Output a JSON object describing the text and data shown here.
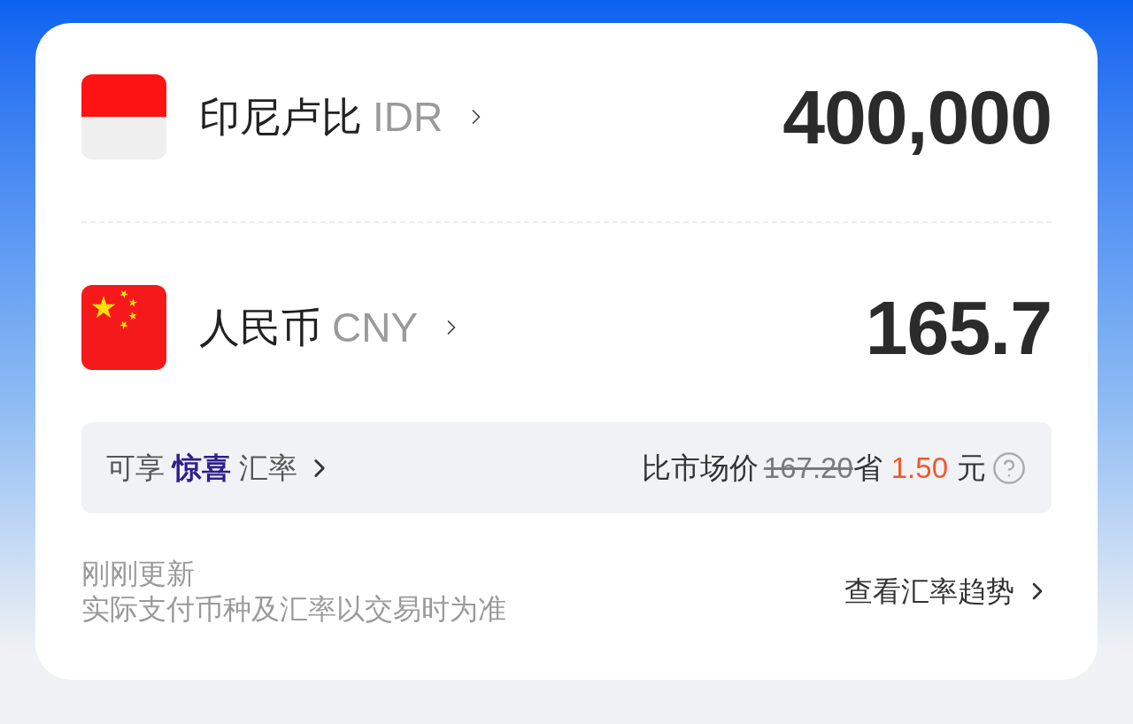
{
  "currencies": [
    {
      "kind": "indonesia",
      "name": "印尼卢比",
      "code": "IDR",
      "amount": "400,000"
    },
    {
      "kind": "china",
      "name": "人民币",
      "code": "CNY",
      "amount": "165.7"
    }
  ],
  "rate_offer": {
    "text": "可享 **惊喜** 汇率",
    "comparison_label": "比市场价",
    "market_price": "167.20",
    "savings_label": "省",
    "savings": "1.50",
    "unit": "元"
  },
  "footer": {
    "status": "刚刚更新",
    "note": "实际支付币种及汇率以交易时为准",
    "link": "查看汇率趋势"
  }
}
